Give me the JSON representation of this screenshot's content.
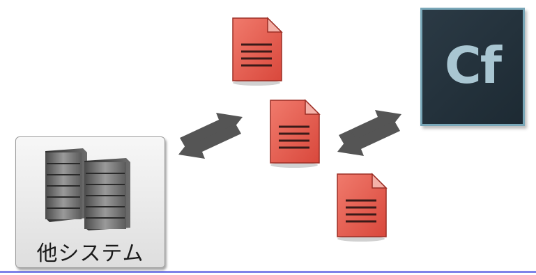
{
  "system": {
    "label": "他システム",
    "icon": "server-rack-icon"
  },
  "logo": {
    "text": "Cf",
    "icon": "coldfusion-logo"
  },
  "documents": [
    "document-icon",
    "document-icon",
    "document-icon"
  ],
  "exchange_arrows": [
    "bidirectional-arrows-icon",
    "bidirectional-arrows-icon"
  ],
  "colors": {
    "document_fill": "#e8584a",
    "arrow": "#555555",
    "logo_bg": "#1f2c35",
    "logo_text": "#a9c6d2",
    "bottom_rule": "#7f83e8"
  }
}
